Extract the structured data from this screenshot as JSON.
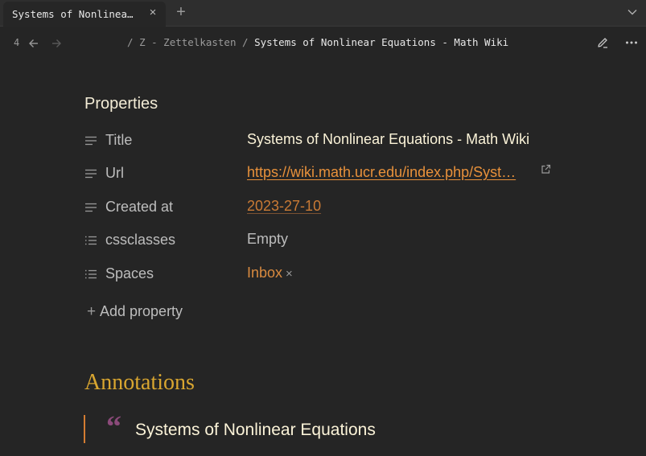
{
  "tab": {
    "title": "Systems of Nonlinea…",
    "close_icon": "close-icon",
    "new_tab_icon": "plus-icon",
    "menu_icon": "chevron-down-icon"
  },
  "nav": {
    "count": "4",
    "breadcrumb": {
      "sep1": "/",
      "parent": "Z - Zettelkasten",
      "sep2": "/",
      "current": "Systems of Nonlinear Equations - Math Wiki"
    }
  },
  "properties": {
    "heading": "Properties",
    "rows": [
      {
        "key": "Title",
        "value": "Systems of Nonlinear Equations - Math Wiki",
        "icon": "text-lines-icon"
      },
      {
        "key": "Url",
        "value": "https://wiki.math.ucr.edu/index.php/Syst…",
        "icon": "text-lines-icon"
      },
      {
        "key": "Created at",
        "value": "2023-27-10",
        "icon": "text-lines-icon"
      },
      {
        "key": "cssclasses",
        "value": "Empty",
        "icon": "list-icon"
      },
      {
        "key": "Spaces",
        "value": "Inbox",
        "tag_remove": "×",
        "icon": "list-icon"
      }
    ],
    "add_label": "Add property",
    "add_plus": "+"
  },
  "annotations": {
    "heading": "Annotations",
    "quote_mark": "“",
    "quote_text": "Systems of Nonlinear Equations"
  },
  "colors": {
    "accent": "#e8913b",
    "heading_gold": "#d9a630",
    "quote_border": "#d47c32",
    "quote_mark": "#8b4a7a"
  }
}
